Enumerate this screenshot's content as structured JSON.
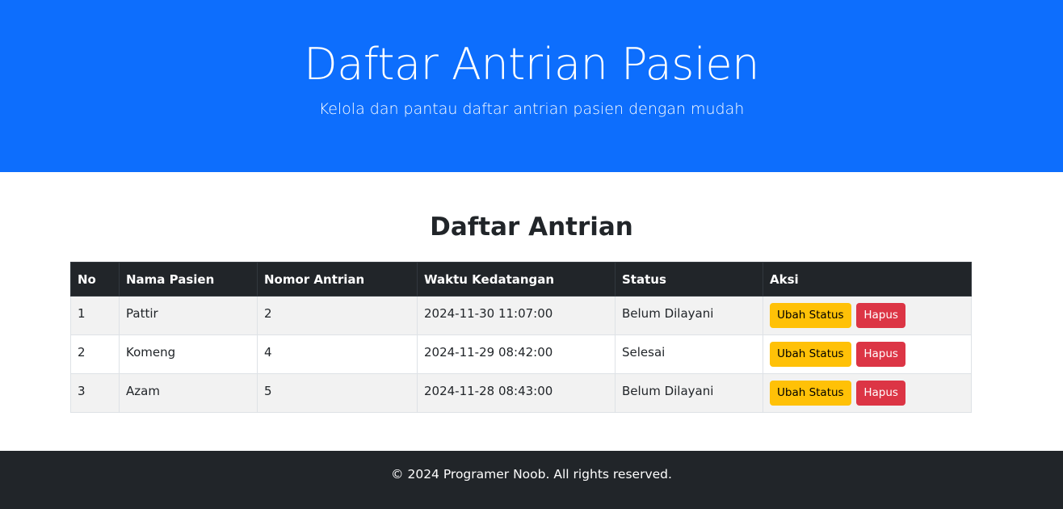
{
  "hero": {
    "title": "Daftar Antrian Pasien",
    "subtitle": "Kelola dan pantau daftar antrian pasien dengan mudah"
  },
  "main": {
    "heading": "Daftar Antrian",
    "table": {
      "columns": [
        "No",
        "Nama Pasien",
        "Nomor Antrian",
        "Waktu Kedatangan",
        "Status",
        "Aksi"
      ],
      "rows": [
        {
          "no": "1",
          "name": "Pattir",
          "queue_number": "2",
          "arrival": "2024-11-30 11:07:00",
          "status": "Belum Dilayani"
        },
        {
          "no": "2",
          "name": "Komeng",
          "queue_number": "4",
          "arrival": "2024-11-29 08:42:00",
          "status": "Selesai"
        },
        {
          "no": "3",
          "name": "Azam",
          "queue_number": "5",
          "arrival": "2024-11-28 08:43:00",
          "status": "Belum Dilayani"
        }
      ],
      "actions": {
        "change_status_label": "Ubah Status",
        "delete_label": "Hapus"
      }
    }
  },
  "footer": {
    "text": "© 2024 Programer Noob. All rights reserved."
  },
  "colors": {
    "hero_bg": "#0d6efd",
    "table_header_bg": "#212529",
    "warning": "#ffc107",
    "danger": "#dc3545",
    "footer_bg": "#212529"
  }
}
